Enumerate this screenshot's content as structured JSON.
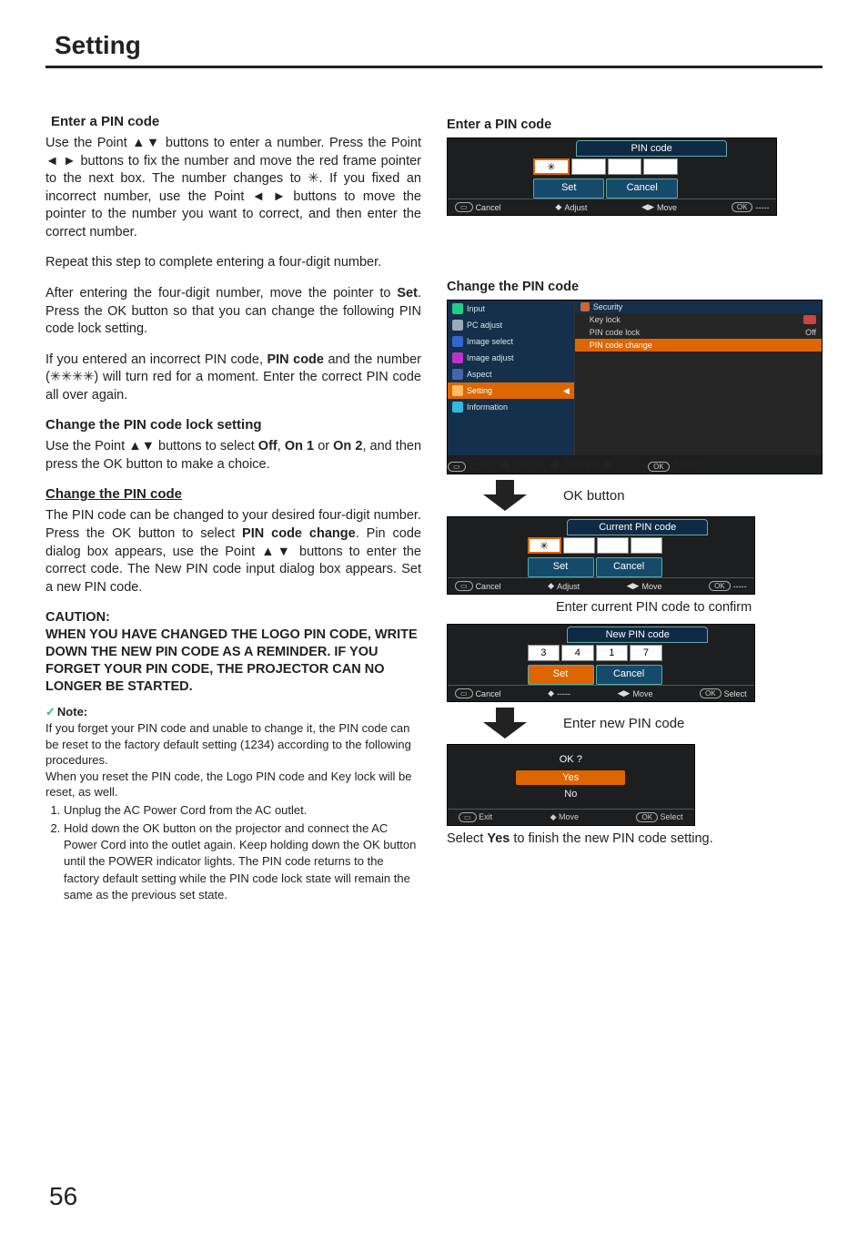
{
  "page": {
    "title": "Setting",
    "number": "56"
  },
  "left": {
    "h_enter": "Enter a PIN code",
    "p_enter": "Use the Point ▲▼ buttons to enter a number. Press the Point ◄ ► buttons to fix the number and move the red frame pointer to the next box. The number changes to ✳. If you fixed an incorrect number, use the Point ◄ ► buttons to move the pointer to the number you want to correct, and then enter the correct number.",
    "p_repeat": "Repeat this step to complete entering a four-digit number.",
    "p_after_a": "After entering the four-digit number, move the pointer to ",
    "p_after_set": "Set",
    "p_after_b": ". Press the OK button so that you can change the following PIN code lock setting.",
    "p_incorrect_a": "If you entered an incorrect PIN code, ",
    "p_incorrect_pin": "PIN code",
    "p_incorrect_b": " and the number (✳✳✳✳) will turn red for a moment. Enter the correct PIN code all over again.",
    "h_change_lock": "Change the PIN code lock setting",
    "p_change_lock_a": "Use the Point ▲▼ buttons to select ",
    "opt_off": "Off",
    "opt_on1": "On 1",
    "opt_on2": "On 2",
    "p_change_lock_b": ", and then press the OK button to make a choice.",
    "h_change_pin": "Change the PIN code",
    "p_change_pin_a": "The PIN code can be changed to your desired four-digit number. Press the OK button to select ",
    "pin_code_change": "PIN code change",
    "p_change_pin_b": ". Pin code dialog box appears, use the Point ▲▼ buttons to enter the correct code. The New PIN code input dialog box appears. Set a new PIN code.",
    "caution_h": "CAUTION:",
    "caution_t": "WHEN YOU HAVE CHANGED THE LOGO PIN CODE, WRITE DOWN THE NEW PIN CODE AS A REMINDER. IF YOU FORGET YOUR PIN CODE, THE PROJECTOR CAN NO LONGER BE STARTED.",
    "note_label": "Note",
    "note1": "If you forget your PIN code and unable to change it, the PIN code can be reset to the factory default setting (1234) according to the following procedures.",
    "note2": "When you reset the PIN code, the Logo PIN code and Key lock will be reset, as well.",
    "note_li1": "Unplug the AC Power Cord from the AC outlet.",
    "note_li2": "Hold down the OK button on the projector and connect the AC Power Cord into the outlet again. Keep holding down the OK button until the POWER indicator lights. The PIN code returns to the factory default setting while the PIN code lock state will remain the same as the previous set state."
  },
  "right": {
    "h_enter": "Enter a PIN code",
    "pin_title": "PIN code",
    "btn_set": "Set",
    "btn_cancel": "Cancel",
    "nav_cancel": "Cancel",
    "nav_adjust": "Adjust",
    "nav_move": "Move",
    "nav_dashes": "-----",
    "h_change": "Change the PIN code",
    "menu": {
      "items": [
        "Input",
        "PC adjust",
        "Image select",
        "Image adjust",
        "Aspect",
        "Setting",
        "Information"
      ],
      "sel_index": 5,
      "panel_title": "Security",
      "opts": [
        {
          "label": "Key lock",
          "val": ""
        },
        {
          "label": "PIN code lock",
          "val": "Off"
        },
        {
          "label": "PIN code change",
          "val": ""
        }
      ],
      "sel_opt": 2,
      "nav": [
        "Exit",
        "Back",
        "Move",
        "-----",
        "Next"
      ]
    },
    "arrow1": "OK button",
    "current_title": "Current PIN code",
    "hint_current": "Enter current PIN code to confirm",
    "new_title": "New PIN code",
    "new_cells": [
      "3",
      "4",
      "1",
      "7"
    ],
    "nav_select": "Select",
    "arrow2": "Enter new PIN code",
    "ok_q": "OK ?",
    "yes": "Yes",
    "no": "No",
    "nav_exit": "Exit",
    "final_a": "Select ",
    "final_yes": "Yes",
    "final_b": " to finish the new PIN code setting."
  }
}
